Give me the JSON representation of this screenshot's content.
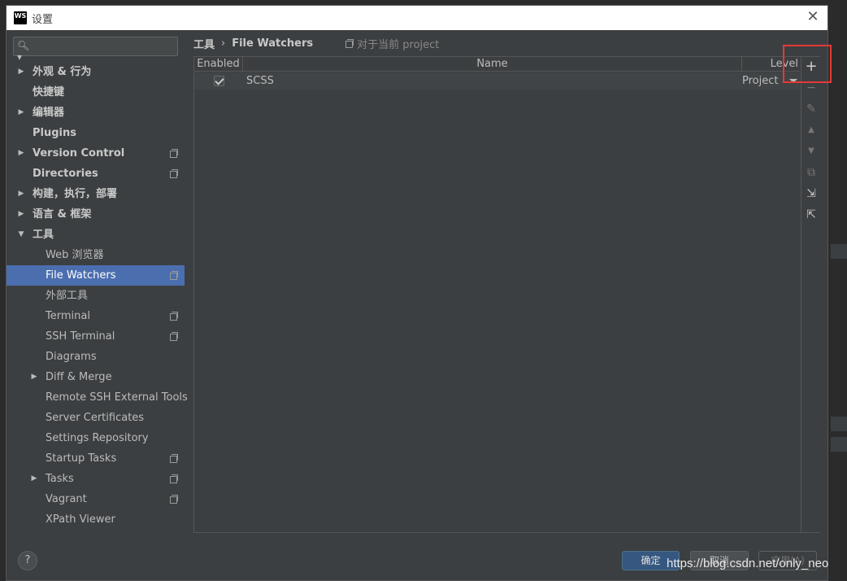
{
  "window": {
    "title": "设置",
    "app_icon_text": "WS"
  },
  "search": {
    "placeholder": ""
  },
  "sidebar": {
    "items": [
      {
        "label": "外观 & 行为",
        "arrow": "▶",
        "bold": true,
        "proj": false
      },
      {
        "label": "快捷键",
        "arrow": "",
        "bold": true,
        "proj": false
      },
      {
        "label": "编辑器",
        "arrow": "▶",
        "bold": true,
        "proj": false
      },
      {
        "label": "Plugins",
        "arrow": "",
        "bold": true,
        "proj": false
      },
      {
        "label": "Version Control",
        "arrow": "▶",
        "bold": true,
        "proj": true
      },
      {
        "label": "Directories",
        "arrow": "",
        "bold": true,
        "proj": true
      },
      {
        "label": "构建，执行，部署",
        "arrow": "▶",
        "bold": true,
        "proj": false
      },
      {
        "label": "语言 & 框架",
        "arrow": "▶",
        "bold": true,
        "proj": false
      },
      {
        "label": "工具",
        "arrow": "▼",
        "bold": true,
        "proj": false
      },
      {
        "label": "Web 浏览器",
        "arrow": "",
        "bold": false,
        "proj": false
      },
      {
        "label": "File Watchers",
        "arrow": "",
        "bold": false,
        "proj": true
      },
      {
        "label": "外部工具",
        "arrow": "",
        "bold": false,
        "proj": false
      },
      {
        "label": "Terminal",
        "arrow": "",
        "bold": false,
        "proj": true
      },
      {
        "label": "SSH Terminal",
        "arrow": "",
        "bold": false,
        "proj": true
      },
      {
        "label": "Diagrams",
        "arrow": "",
        "bold": false,
        "proj": false
      },
      {
        "label": "Diff & Merge",
        "arrow": "▶",
        "bold": false,
        "proj": false
      },
      {
        "label": "Remote SSH External Tools",
        "arrow": "",
        "bold": false,
        "proj": false
      },
      {
        "label": "Server Certificates",
        "arrow": "",
        "bold": false,
        "proj": false
      },
      {
        "label": "Settings Repository",
        "arrow": "",
        "bold": false,
        "proj": false
      },
      {
        "label": "Startup Tasks",
        "arrow": "",
        "bold": false,
        "proj": true
      },
      {
        "label": "Tasks",
        "arrow": "▶",
        "bold": false,
        "proj": true
      },
      {
        "label": "Vagrant",
        "arrow": "",
        "bold": false,
        "proj": true
      },
      {
        "label": "XPath Viewer",
        "arrow": "",
        "bold": false,
        "proj": false
      }
    ],
    "selected": "File Watchers"
  },
  "breadcrumb": {
    "parent": "工具",
    "separator": "›",
    "current": "File Watchers",
    "scope": "对于当前 project"
  },
  "table": {
    "headers": {
      "enabled": "Enabled",
      "name": "Name",
      "level": "Level"
    },
    "rows": [
      {
        "enabled": true,
        "name": "SCSS",
        "level": "Project"
      }
    ]
  },
  "toolbar": {
    "add": "+",
    "remove": "−",
    "edit": "✎",
    "move_up": "▲",
    "move_down": "▼",
    "copy": "⧉",
    "import": "⇲",
    "export": "⇱"
  },
  "footer": {
    "help": "?",
    "ok": "确定",
    "cancel": "取消",
    "apply": "应用(A)"
  },
  "watermark": "https://blog.csdn.net/only_neo",
  "colors": {
    "selection": "#4b6eaf",
    "highlight": "#e53935",
    "ok_button": "#365880"
  }
}
